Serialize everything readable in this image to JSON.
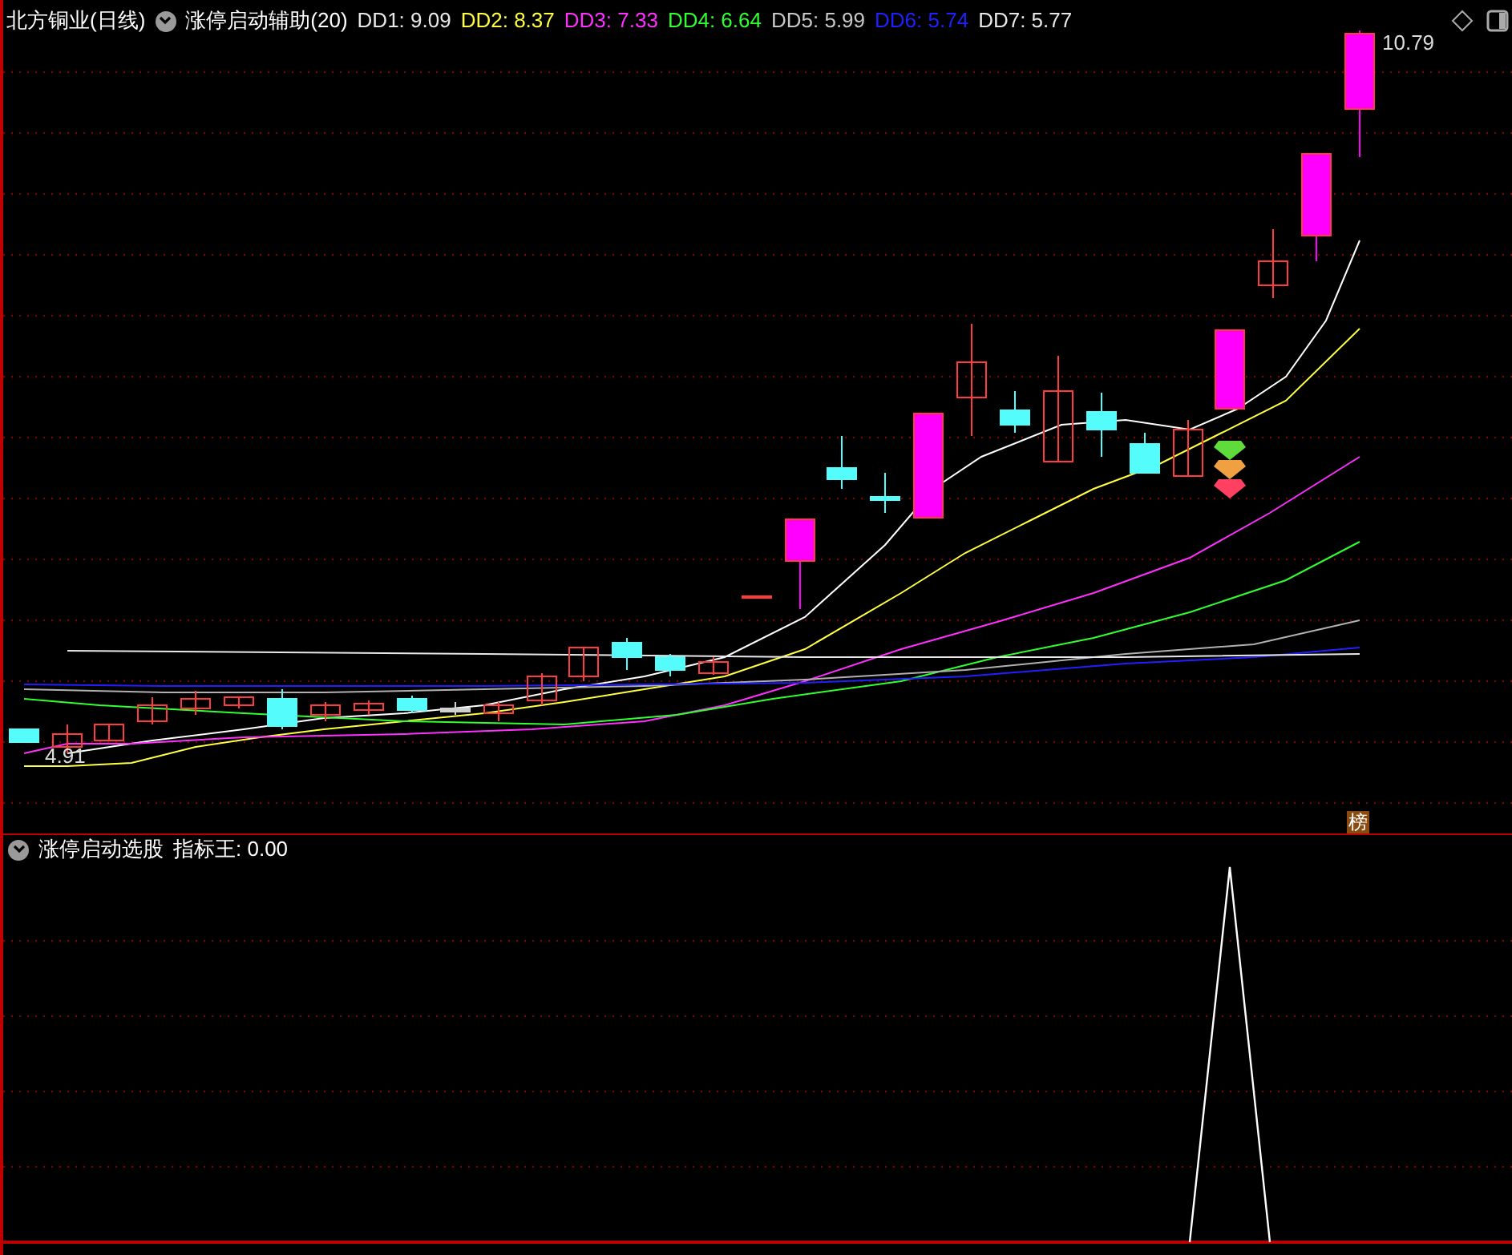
{
  "main_panel": {
    "title": "北方铜业(日线)",
    "indicator": "涨停启动辅助(20)",
    "legend": [
      {
        "label": "DD1: 9.09",
        "color": "#e8e8e8"
      },
      {
        "label": "DD2: 8.37",
        "color": "#ffff40"
      },
      {
        "label": "DD3: 7.33",
        "color": "#ff30ff"
      },
      {
        "label": "DD4: 6.64",
        "color": "#30ff30"
      },
      {
        "label": "DD5: 5.99",
        "color": "#c8c8c8"
      },
      {
        "label": "DD6: 5.74",
        "color": "#2020ff"
      },
      {
        "label": "DD7: 5.77",
        "color": "#e8e8e8"
      }
    ],
    "high_label": "10.79",
    "low_label": "4.91",
    "badge": "榜"
  },
  "sub_panel": {
    "title": "涨停启动选股",
    "value_label": "指标王: 0.00"
  }
}
